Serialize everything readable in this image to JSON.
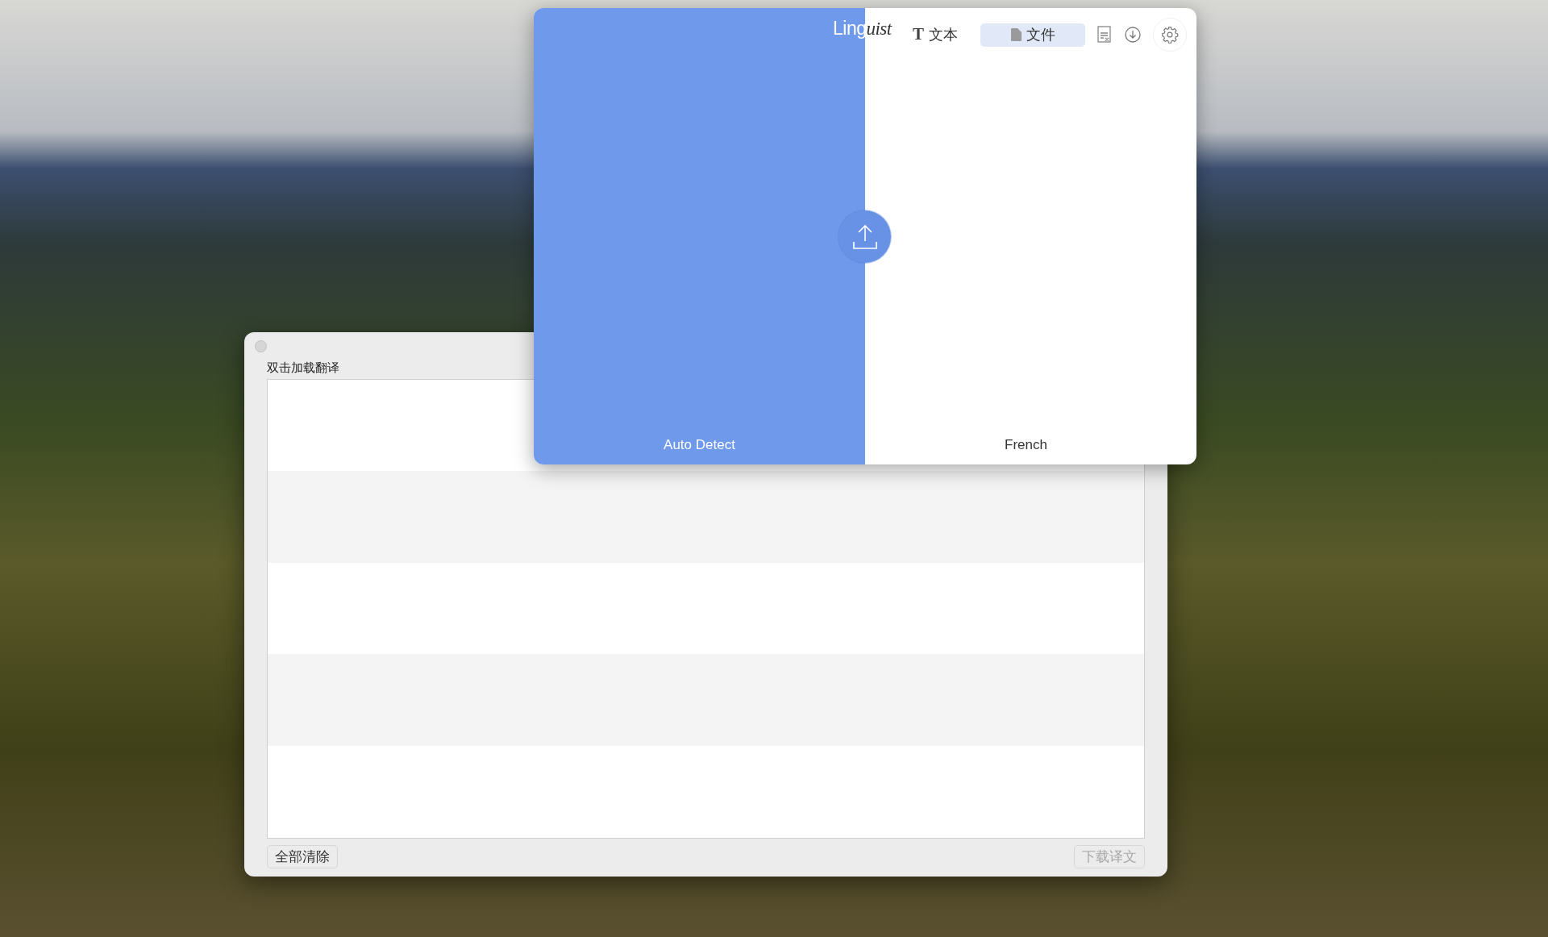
{
  "translator": {
    "logo": [
      "Ling",
      "uist"
    ],
    "tabs": [
      {
        "kind": "text",
        "glyph": "T",
        "label": "文本",
        "selected": false
      },
      {
        "kind": "file",
        "label": "文件",
        "selected": true
      }
    ],
    "source_language": "Auto Detect",
    "target_language": "French"
  },
  "file_window": {
    "title": "双击加载翻译",
    "buttons": [
      {
        "label": "全部清除",
        "disabled": false
      },
      {
        "label": "下载译文",
        "disabled": true
      }
    ]
  }
}
